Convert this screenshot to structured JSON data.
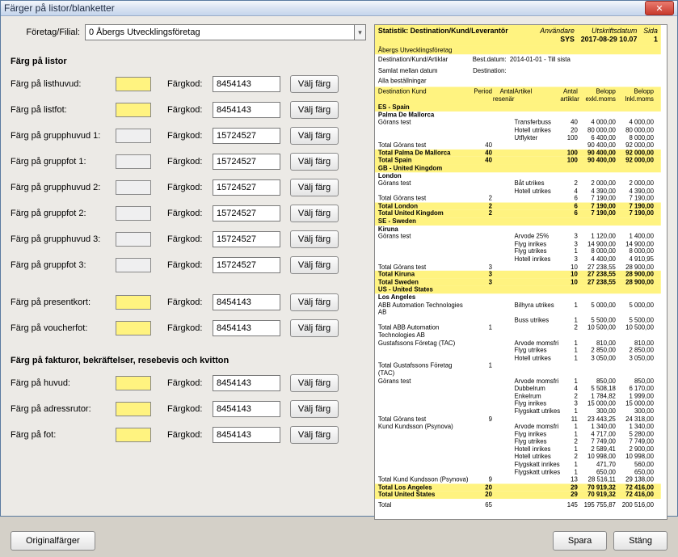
{
  "window": {
    "title": "Färger på listor/blanketter"
  },
  "company": {
    "label": "Företag/Filial:",
    "value": "0  Åbergs Utvecklingsföretag"
  },
  "sections": {
    "listor": "Färg på listor",
    "fakturor": "Färg på fakturor, bekräftelser, resebevis och kvitton"
  },
  "labels": {
    "fargkod": "Färgkod:",
    "pick": "Välj färg"
  },
  "rows": {
    "listhuvud": {
      "label": "Färg på listhuvud:",
      "code": "8454143"
    },
    "listfot": {
      "label": "Färg på listfot:",
      "code": "8454143"
    },
    "grupphuvud1": {
      "label": "Färg på grupphuvud 1:",
      "code": "15724527"
    },
    "gruppfot1": {
      "label": "Färg på gruppfot 1:",
      "code": "15724527"
    },
    "grupphuvud2": {
      "label": "Färg på grupphuvud 2:",
      "code": "15724527"
    },
    "gruppfot2": {
      "label": "Färg på gruppfot 2:",
      "code": "15724527"
    },
    "grupphuvud3": {
      "label": "Färg på grupphuvud 3:",
      "code": "15724527"
    },
    "gruppfot3": {
      "label": "Färg på gruppfot 3:",
      "code": "15724527"
    },
    "presentkort": {
      "label": "Färg på presentkort:",
      "code": "8454143"
    },
    "voucherfot": {
      "label": "Färg på voucherfot:",
      "code": "8454143"
    },
    "huvud": {
      "label": "Färg på huvud:",
      "code": "8454143"
    },
    "adressrutor": {
      "label": "Färg på adressrutor:",
      "code": "8454143"
    },
    "fot": {
      "label": "Färg på fot:",
      "code": "8454143"
    }
  },
  "buttons": {
    "original": "Originalfärger",
    "save": "Spara",
    "close": "Stäng"
  },
  "report": {
    "title": "Statistik: Destination/Kund/Leverantör",
    "user_lbl": "Användare",
    "user": "SYS",
    "date_lbl": "Utskriftsdatum",
    "date": "2017-08-29 10.07",
    "page_lbl": "Sida",
    "page": "1",
    "subtitle": "Åbergs Utvecklingsföretag",
    "info1a": "Destination/Kund/Artiklar",
    "info1b": "Best.datum:",
    "info1c": "2014-01-01  -  Till sista",
    "info2a": "Samlat mellan datum",
    "info2b": "Destination:",
    "info3": "Alla beställningar",
    "colhdr": {
      "c1": "Destination Kund",
      "c2": "Period",
      "c3": "Antal resenär",
      "c4": "Artikel",
      "c5": "Antal artiklar",
      "c6": "Belopp exkl.moms",
      "c7": "Belopp Inkl.moms"
    },
    "groups": {
      "es": {
        "hdr": "ES - Spain",
        "sub": "Palma De Mallorca",
        "lines": [
          {
            "c1": "Görans test",
            "c4": "Transferbuss",
            "c5": "40",
            "c6": "4 000,00",
            "c7": "4 000,00"
          },
          {
            "c4": "Hotell utrikes",
            "c5": "20",
            "c6": "80 000,00",
            "c7": "80 000,00"
          },
          {
            "c4": "Utflykter",
            "c5": "100",
            "c6": "6 400,00",
            "c7": "8 000,00"
          }
        ],
        "sum1": {
          "c1": "Total Görans test",
          "c2": "40",
          "c5": "",
          "c6": "90 400,00",
          "c7": "92 000,00"
        },
        "sum2": {
          "c1": "Total Palma De Mallorca",
          "c2": "40",
          "c5": "100",
          "c6": "90 400,00",
          "c7": "92 000,00"
        },
        "sum3": {
          "c1": "Total Spain",
          "c2": "40",
          "c5": "100",
          "c6": "90 400,00",
          "c7": "92 000,00"
        }
      },
      "gb": {
        "hdr": "GB - United Kingdom",
        "sub": "London",
        "lines": [
          {
            "c1": "Görans test",
            "c4": "Båt utrikes",
            "c5": "2",
            "c6": "2 000,00",
            "c7": "2 000,00"
          },
          {
            "c4": "Hotell utrikes",
            "c5": "4",
            "c6": "4 390,00",
            "c7": "4 390,00"
          }
        ],
        "sum1": {
          "c1": "Total Görans test",
          "c2": "2",
          "c5": "6",
          "c6": "7 190,00",
          "c7": "7 190,00"
        },
        "sum2": {
          "c1": "Total London",
          "c2": "2",
          "c5": "6",
          "c6": "7 190,00",
          "c7": "7 190,00"
        },
        "sum3": {
          "c1": "Total United Kingdom",
          "c2": "2",
          "c5": "6",
          "c6": "7 190,00",
          "c7": "7 190,00"
        }
      },
      "se": {
        "hdr": "SE - Sweden",
        "sub": "Kiruna",
        "lines": [
          {
            "c1": "Görans test",
            "c4": "Arvode 25%",
            "c5": "3",
            "c6": "1 120,00",
            "c7": "1 400,00"
          },
          {
            "c4": "Flyg inrikes",
            "c5": "3",
            "c6": "14 900,00",
            "c7": "14 900,00"
          },
          {
            "c4": "Flyg utrikes",
            "c5": "1",
            "c6": "8 000,00",
            "c7": "8 000,00"
          },
          {
            "c4": "Hotell inrikes",
            "c5": "3",
            "c6": "4 400,00",
            "c7": "4 910,95"
          }
        ],
        "sum1": {
          "c1": "Total Görans test",
          "c2": "3",
          "c5": "10",
          "c6": "27 238,55",
          "c7": "28 900,00"
        },
        "sum2": {
          "c1": "Total Kiruna",
          "c2": "3",
          "c5": "10",
          "c6": "27 238,55",
          "c7": "28 900,00"
        },
        "sum3": {
          "c1": "Total Sweden",
          "c2": "3",
          "c5": "10",
          "c6": "27 238,55",
          "c7": "28 900,00"
        }
      },
      "us": {
        "hdr": "US - United States",
        "sub": "Los Angeles",
        "lines": [
          {
            "c1": "ABB Automation Technologies AB",
            "c4": "Bilhyra utrikes",
            "c5": "1",
            "c6": "5 000,00",
            "c7": "5 000,00"
          },
          {
            "c4": "Buss utrikes",
            "c5": "1",
            "c6": "5 500,00",
            "c7": "5 500,00"
          }
        ],
        "sum_abb": {
          "c1": "Total ABB Automation Technologies AB",
          "c2": "1",
          "c5": "2",
          "c6": "10 500,00",
          "c7": "10 500,00"
        },
        "lines2": [
          {
            "c1": "Gustafssons Företag (TAC)",
            "c4": "Arvode momsfri",
            "c5": "1",
            "c6": "810,00",
            "c7": "810,00"
          },
          {
            "c4": "Flyg utrikes",
            "c5": "1",
            "c6": "2 850,00",
            "c7": "2 850,00"
          },
          {
            "c4": "Hotell utrikes",
            "c5": "1",
            "c6": "3 050,00",
            "c7": "3 050,00"
          }
        ],
        "sum_gust": {
          "c1": "Total Gustafssons Företag (TAC)",
          "c2": "1",
          "c5": "",
          "c6": "",
          "c7": ""
        },
        "lines3": [
          {
            "c1": "Görans test",
            "c4": "Arvode momsfri",
            "c5": "1",
            "c6": "850,00",
            "c7": "850,00"
          },
          {
            "c4": "Dubbelrum",
            "c5": "4",
            "c6": "5 508,18",
            "c7": "6 170,00"
          },
          {
            "c4": "Enkelrum",
            "c5": "2",
            "c6": "1 784,82",
            "c7": "1 999,00"
          },
          {
            "c4": "Flyg inrikes",
            "c5": "3",
            "c6": "15 000,00",
            "c7": "15 000,00"
          },
          {
            "c4": "Flygskatt utrikes",
            "c5": "1",
            "c6": "300,00",
            "c7": "300,00"
          }
        ],
        "sum_goran": {
          "c1": "Total Görans test",
          "c2": "9",
          "c5": "11",
          "c6": "23 443,25",
          "c7": "24 318,00"
        },
        "lines4": [
          {
            "c1": "Kund Kundsson (Psynova)",
            "c4": "Arvode momsfri",
            "c5": "1",
            "c6": "1 340,00",
            "c7": "1 340,00"
          },
          {
            "c4": "Flyg inrikes",
            "c5": "1",
            "c6": "4 717,00",
            "c7": "5 280,00"
          },
          {
            "c4": "Flyg utrikes",
            "c5": "2",
            "c6": "7 749,00",
            "c7": "7 749,00"
          },
          {
            "c4": "Hotell inrikes",
            "c5": "1",
            "c6": "2 589,41",
            "c7": "2 900,00"
          },
          {
            "c4": "Hotell utrikes",
            "c5": "2",
            "c6": "10 998,00",
            "c7": "10 998,00"
          },
          {
            "c4": "Flygskatt inrikes",
            "c5": "1",
            "c6": "471,70",
            "c7": "560,00"
          },
          {
            "c4": "Flygskatt utrikes",
            "c5": "1",
            "c6": "650,00",
            "c7": "650,00"
          }
        ],
        "sum_kund": {
          "c1": "Total Kund Kundsson (Psynova)",
          "c2": "9",
          "c5": "13",
          "c6": "28 516,11",
          "c7": "29 138,00"
        },
        "sum_la": {
          "c1": "Total Los Angeles",
          "c2": "20",
          "c5": "29",
          "c6": "70 919,32",
          "c7": "72 416,00"
        },
        "sum_us": {
          "c1": "Total United States",
          "c2": "20",
          "c5": "29",
          "c6": "70 919,32",
          "c7": "72 416,00"
        }
      }
    },
    "grand": {
      "c1": "Total",
      "c2": "65",
      "c5": "145",
      "c6": "195 755,87",
      "c7": "200 516,00"
    }
  }
}
